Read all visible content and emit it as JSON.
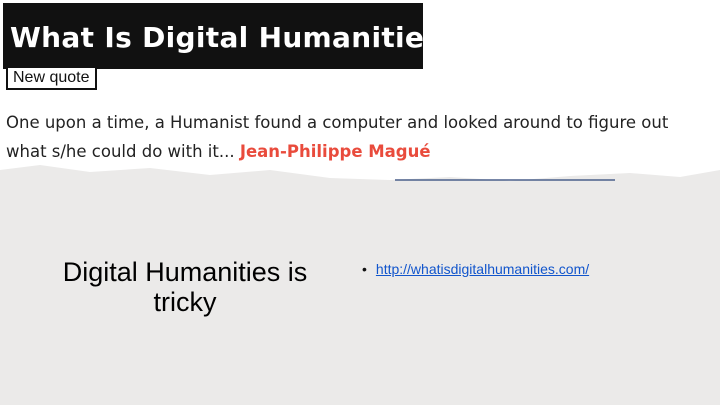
{
  "title": "What Is Digital Humanities?",
  "new_quote_button": "New quote",
  "quote": {
    "text": "One upon a time, a Humanist found a computer and looked around to figure out what s/he could do with it...",
    "author": "Jean-Philippe Magué"
  },
  "slide": {
    "heading": "Digital Humanities is tricky",
    "links": [
      {
        "label": "http://whatisdigitalhumanities.com/"
      }
    ]
  },
  "colors": {
    "title_background": "#111111",
    "author": "#e94b3c",
    "slide_background": "#ebeae9",
    "link": "#1155cc"
  }
}
